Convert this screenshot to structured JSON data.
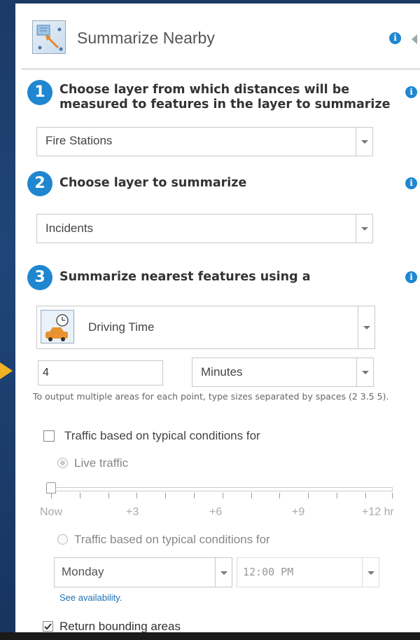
{
  "header": {
    "title": "Summarize Nearby",
    "icon": "summarize-nearby-icon",
    "info_icon": "info-icon",
    "collapse_icon": "collapse-arrow-icon"
  },
  "steps": [
    {
      "number": "1",
      "title_line1": "Choose layer from which distances will be",
      "title_line2": "measured to features in the layer to summarize",
      "select_value": "Fire Stations"
    },
    {
      "number": "2",
      "title_line1": "Choose layer to summarize",
      "select_value": "Incidents"
    },
    {
      "number": "3",
      "title_line1": "Summarize nearest features using a",
      "select_value": "Driving Time",
      "select_icon": "driving-time-icon"
    }
  ],
  "distance": {
    "value": "4",
    "unit": "Minutes",
    "hint": "To output multiple areas for each point, type sizes separated by spaces (2 3.5 5)."
  },
  "traffic": {
    "checkbox_label": "Traffic based on typical conditions for",
    "checked": false,
    "live_label": "Live traffic",
    "slider_value_hours": 0,
    "tick_labels": [
      "Now",
      "+3",
      "+6",
      "+9",
      "+12 hr"
    ],
    "typical_label": "Traffic based on typical conditions for",
    "day": "Monday",
    "time": "12:00 PM",
    "availability_link": "See availability."
  },
  "bounding": {
    "label": "Return bounding areas",
    "checked": true
  },
  "colors": {
    "accent": "#1f86d0",
    "background": "#1f4578",
    "marker": "#f0b323"
  }
}
